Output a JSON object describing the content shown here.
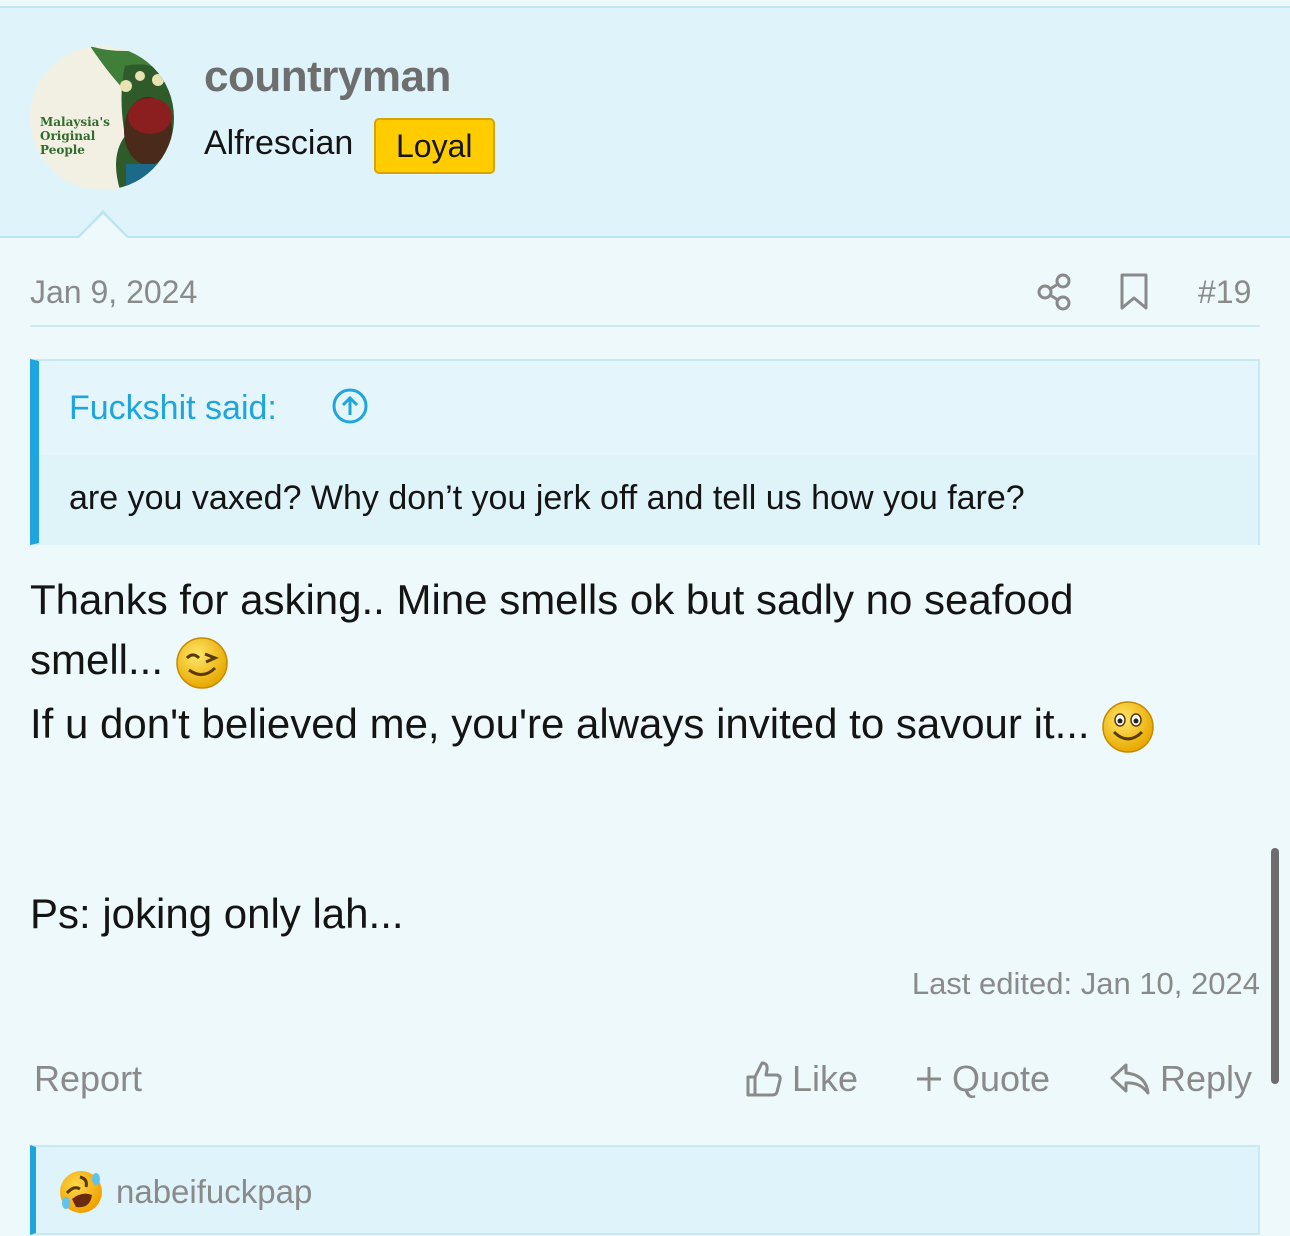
{
  "post": {
    "author": {
      "username": "countryman",
      "user_title": "Alfrescian",
      "badge": "Loyal",
      "avatar_text": [
        "Malaysia's",
        "Original",
        "People"
      ]
    },
    "date": "Jan 9, 2024",
    "post_number": "#19",
    "quote": {
      "header": "Fuckshit said:",
      "text": "are you vaxed? Why don’t you jerk off and tell us how you fare?"
    },
    "body": {
      "line1": "Thanks for asking.. Mine smells ok but sadly no seafood",
      "line2": "smell...",
      "line3": "If u don't believed me, you're always invited to savour it...",
      "line4": "Ps: joking only lah..."
    },
    "last_edited": "Last edited: Jan 10, 2024",
    "actions": {
      "report": "Report",
      "like": "Like",
      "quote": "Quote",
      "reply": "Reply"
    },
    "reactions": {
      "user": "nabeifuckpap",
      "emoji": "rofl-emoji"
    }
  },
  "colors": {
    "accent": "#1ea5dd",
    "badge": "#ffcc00",
    "header_bg": "#dff4fa",
    "page_bg": "#eef9fc",
    "muted_text": "#8a8a8a"
  }
}
